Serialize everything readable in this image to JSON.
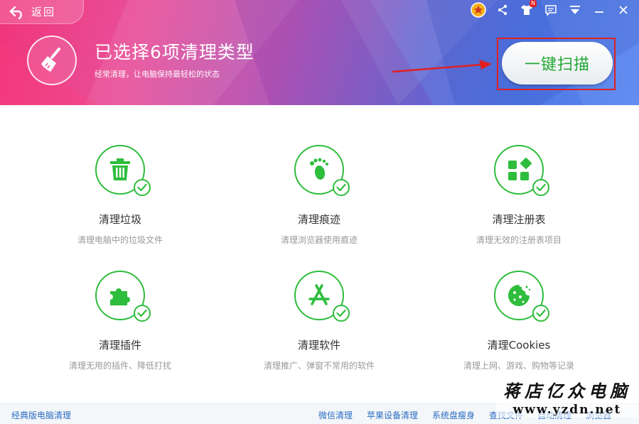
{
  "header": {
    "back_label": "返回",
    "title": "已选择6项清理类型",
    "subtitle": "经常清理，让电脑保持最轻松的状态",
    "scan_button": "一键扫描",
    "badge": "N"
  },
  "items": [
    {
      "name": "清理垃圾",
      "desc": "清理电脑中的垃圾文件",
      "icon": "trash-icon"
    },
    {
      "name": "清理痕迹",
      "desc": "清理浏览器使用痕迹",
      "icon": "footprint-icon"
    },
    {
      "name": "清理注册表",
      "desc": "清理无效的注册表项目",
      "icon": "registry-icon"
    },
    {
      "name": "清理插件",
      "desc": "清理无用的插件、降低打扰",
      "icon": "puzzle-icon"
    },
    {
      "name": "清理软件",
      "desc": "清理推广、弹窗不常用的软件",
      "icon": "app-store-icon"
    },
    {
      "name": "清理Cookies",
      "desc": "清理上网、游戏、购物等记录",
      "icon": "cookie-icon"
    }
  ],
  "footer": {
    "left_link": "经典版电脑清理",
    "links": [
      "微信清理",
      "苹果设备清理",
      "系统盘瘦身",
      "查找文件",
      "自动清理",
      "浏览器"
    ]
  },
  "watermark": {
    "line1": "蒋店亿众电脑",
    "line2": "www.yzdn.net"
  },
  "colors": {
    "accent_green": "#2ebd3c",
    "link_blue": "#2b6cc4",
    "highlight_red": "#e02020"
  }
}
